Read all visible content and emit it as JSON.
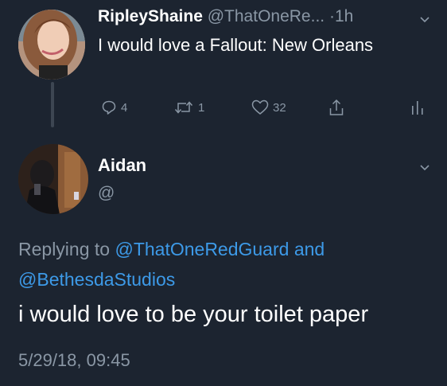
{
  "tweet1": {
    "display_name": "RipleyShaine",
    "handle": "@ThatOneRe...",
    "time_sep": " ·",
    "time": "1h",
    "text": "I would love a Fallout: New Orleans",
    "reply_count": "4",
    "retweet_count": "1",
    "like_count": "32",
    "avatar_icon": "user-photo-avatar"
  },
  "tweet2": {
    "display_name": "Aidan",
    "handle": "@",
    "replying_prefix": "Replying to",
    "replying_to_1": "@ThatOneRedGuard",
    "replying_and": "and",
    "replying_to_2": "@BethesdaStudios",
    "text": "i would love to be your toilet paper",
    "date": "5/29/18, 09:45",
    "avatar_icon": "user-photo-avatar"
  },
  "colors": {
    "background": "#1c2430",
    "secondary_text": "#8a97a5",
    "link": "#3d9ae8",
    "primary_text": "#ffffff"
  }
}
